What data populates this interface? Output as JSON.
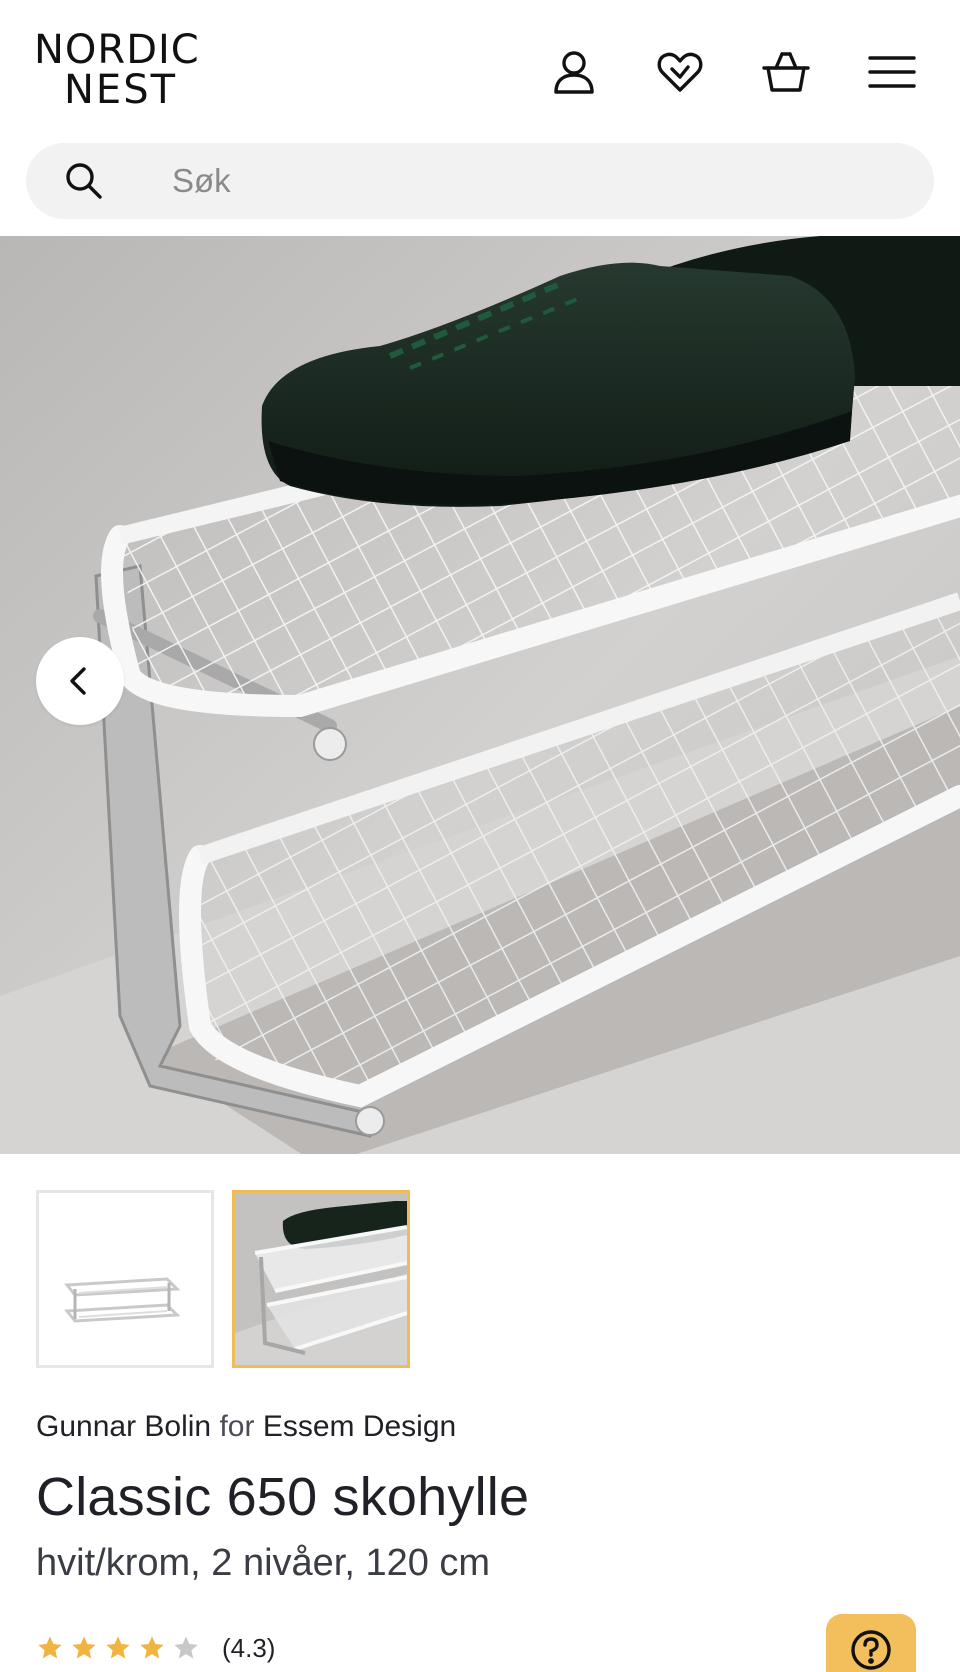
{
  "header": {
    "logo_line1": "NORDIC",
    "logo_line2": "NEST",
    "icons": [
      "user-icon",
      "heart-icon",
      "basket-icon",
      "menu-icon"
    ]
  },
  "search": {
    "placeholder": "Søk",
    "value": ""
  },
  "gallery": {
    "thumbnails": [
      "product-cutout",
      "product-lifestyle"
    ],
    "active_index": 1,
    "accent_color": "#f0bc5a"
  },
  "product": {
    "designer": "Gunnar Bolin",
    "connector": "for",
    "brand": "Essem Design",
    "title": "Classic 650 skohylle",
    "variant": "hvit/krom, 2 nivåer, 120 cm",
    "rating_value": 4.3,
    "rating_text": "(4.3)",
    "rating_max": 5
  },
  "colors": {
    "star_filled": "#f2b441",
    "star_empty": "#c8c8c8",
    "help_button": "#f2bf5c"
  }
}
